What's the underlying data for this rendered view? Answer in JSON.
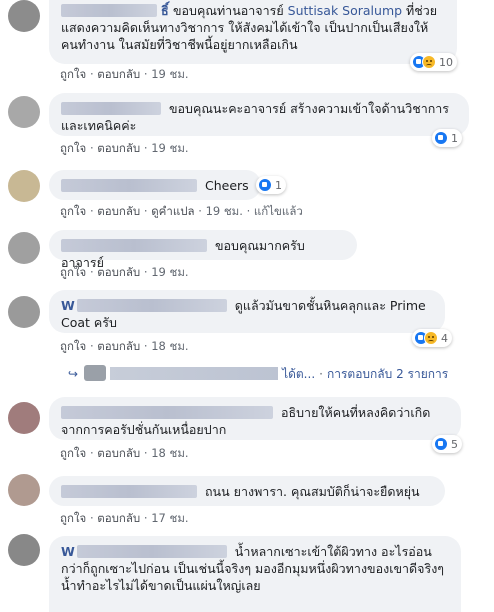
{
  "colors": {
    "link": "#385898",
    "bubble": "#f0f2f5",
    "meta": "#616770",
    "like": "#1877f2",
    "sad": "#f7b928"
  },
  "actions": {
    "like": "ถูกใจ",
    "reply": "ตอบกลับ",
    "sep": "·",
    "see_translation": "ดูคำแปล",
    "edited": "แก้ไขแล้ว"
  },
  "comments": [
    {
      "name_visible": "ธิ์",
      "text": "ขอบคุณท่านอาจารย์",
      "tag": "Suttisak Soralump",
      "text2": "ที่ช่วยแสดงความคิดเห็นทางวิชาการ ให้สังคมได้เข้าใจ เป็นปากเป็นเสียงให้คนทำงาน ในสมัยที่วิชาชีพนี้อยู่ยากเหลือเกิน",
      "time": "19 ชม.",
      "reactions": "10",
      "avatar_color": "#8c8c8c",
      "icons": [
        "like-icon",
        "sad-icon"
      ]
    },
    {
      "text": "ขอบคุณนะคะอาจารย์ สร้างความเข้าใจด้านวิชาการและเทคนิคค่ะ",
      "time": "19 ชม.",
      "reactions": "1",
      "avatar_color": "#a8a8a8",
      "icons": [
        "like-icon"
      ]
    },
    {
      "text": "Cheers",
      "time": "19 ชม.",
      "reactions": "1",
      "avatar_color": "#c8b894",
      "icons": [
        "like-icon"
      ]
    },
    {
      "text": "ขอบคุณมากครับอาจารย์",
      "time": "19 ชม.",
      "avatar_color": "#a0a0a0"
    },
    {
      "name_visible": "W",
      "text": "ดูแล้วมันขาดชั้นหินคลุกและ Prime Coat ครับ",
      "time": "18 ชม.",
      "reactions": "4",
      "avatar_color": "#9a9a9a",
      "icons": [
        "like-icon",
        "sad-icon"
      ]
    },
    {
      "text": "อธิบายให้คนที่หลงคิดว่าเกิดจากการคอรัปชั่นกันเหนื่อยปาก",
      "time": "18 ชม.",
      "reactions": "5",
      "avatar_color": "#a07c7c",
      "icons": [
        "like-icon"
      ]
    },
    {
      "text": "ถนน ยางพารา. คุณสมบัติก็น่าจะยืดหยุ่น",
      "time": "17 ชม.",
      "avatar_color": "#b09a90"
    },
    {
      "name_visible": "W",
      "text": "น้ำหลากเซาะเข้าใต้ผิวทาง อะไรอ่อนกว่าก็ถูกเซาะไปก่อน เป็นเช่นนี้จริงๆ มองอีกมุมหนึ่งผิวทางของเขาดีจริงๆ น้ำทำอะไรไม่ได้ขาดเป็นแผ่นใหญ่เลย",
      "avatar_color": "#888888"
    }
  ],
  "reply_link": {
    "partial": "ได้ต...",
    "label": "การตอบกลับ 2 รายการ"
  }
}
